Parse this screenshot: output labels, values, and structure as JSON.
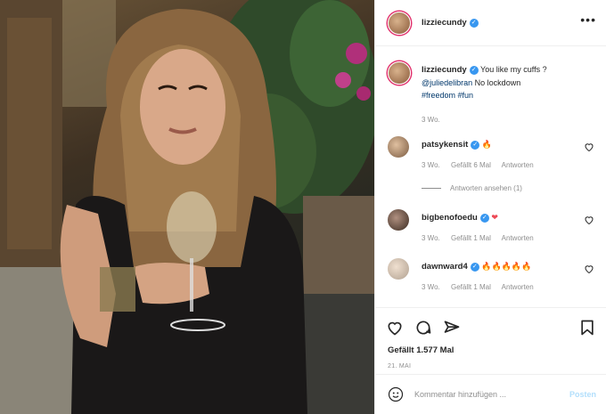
{
  "post": {
    "username": "lizziecundy",
    "verified_icon": "verified-badge-icon",
    "caption_user": "lizziecundy",
    "caption_text": "You like my cuffs ?",
    "caption_mention": "@juliedelibran",
    "caption_after": " No lockdown",
    "hashtag_1": "#freedom",
    "hashtag_2": "#fun",
    "caption_time": "3 Wo."
  },
  "comments": [
    {
      "user": "patsykensit",
      "text": "🔥",
      "time": "3 Wo.",
      "likes": "Gefällt 6 Mal",
      "reply": "Antworten",
      "view_replies": "Antworten ansehen (1)"
    },
    {
      "user": "bigbenofoedu",
      "text": "❤",
      "time": "3 Wo.",
      "likes": "Gefällt 1 Mal",
      "reply": "Antworten"
    },
    {
      "user": "dawnward4",
      "text": "🔥🔥🔥🔥🔥",
      "time": "3 Wo.",
      "likes": "Gefällt 1 Mal",
      "reply": "Antworten"
    }
  ],
  "actions": {
    "like_count": "Gefällt 1.577 Mal",
    "date": "21. MAI"
  },
  "composer": {
    "placeholder": "Kommentar hinzufügen ...",
    "post_label": "Posten"
  },
  "colors": {
    "accent": "#3897f0",
    "link": "#00376b",
    "muted": "#8e8e8e",
    "post_disabled": "#b2dffc",
    "heart_red": "#ed4956"
  }
}
